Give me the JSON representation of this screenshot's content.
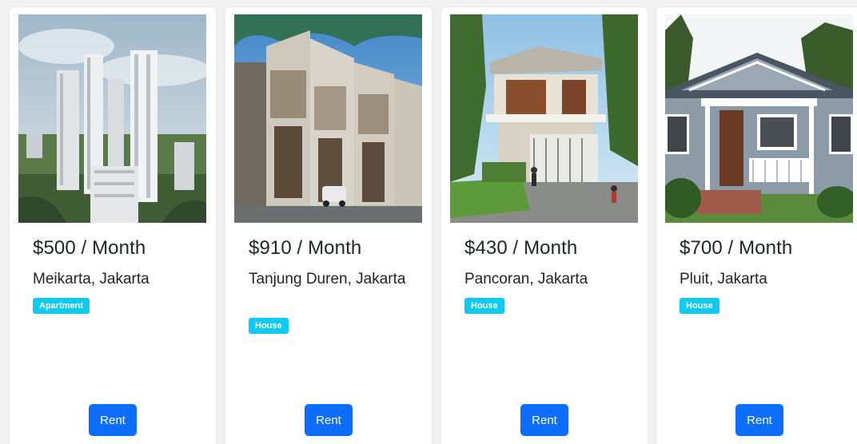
{
  "listings": [
    {
      "price": "$500 / Month",
      "location": "Meikarta, Jakarta",
      "type": "Apartment",
      "button": "Rent",
      "photo_icon": "apartment-towers-photo"
    },
    {
      "price": "$910 / Month",
      "location": "Tanjung Duren, Jakarta",
      "type": "House",
      "button": "Rent",
      "photo_icon": "townhouse-row-photo"
    },
    {
      "price": "$430 / Month",
      "location": "Pancoran, Jakarta",
      "type": "House",
      "button": "Rent",
      "photo_icon": "modern-house-photo"
    },
    {
      "price": "$700 / Month",
      "location": "Pluit, Jakarta",
      "type": "House",
      "button": "Rent",
      "photo_icon": "bungalow-photo"
    }
  ],
  "colors": {
    "badge": "#0dcaf0",
    "button": "#0d6efd",
    "text": "#212529",
    "background": "#f1f1f1"
  }
}
